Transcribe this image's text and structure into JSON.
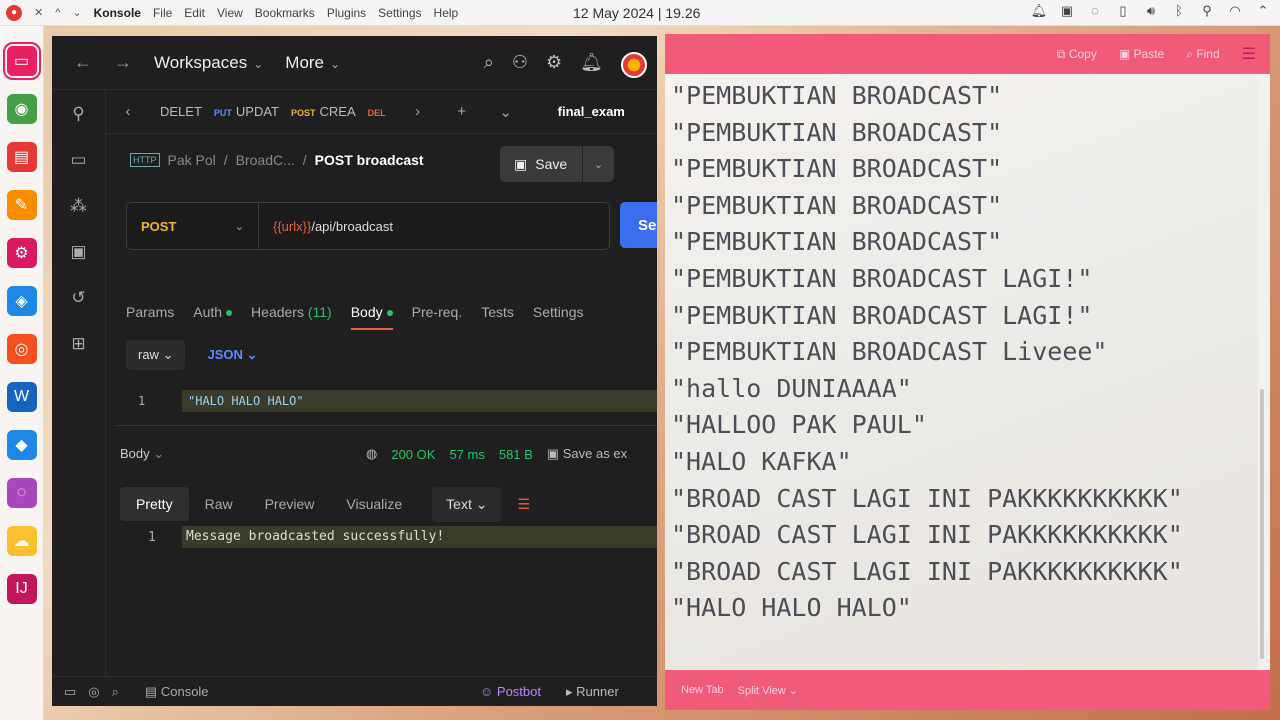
{
  "topbar": {
    "controls": [
      "✕",
      "^",
      "⌄"
    ],
    "app_name": "Konsole",
    "menu": [
      "File",
      "Edit",
      "View",
      "Bookmarks",
      "Plugins",
      "Settings",
      "Help"
    ],
    "clock": "12 May 2024 | 19.26"
  },
  "dock": {
    "items": [
      {
        "name": "konsole-icon",
        "color": "#e91e63",
        "glyph": "▭"
      },
      {
        "name": "chrome-icon",
        "color": "#43a047",
        "glyph": "◉"
      },
      {
        "name": "folder-icon",
        "color": "#e53935",
        "glyph": "▤"
      },
      {
        "name": "editor-icon",
        "color": "#fb8c00",
        "glyph": "✎"
      },
      {
        "name": "settings-icon",
        "color": "#d81b60",
        "glyph": "⚙"
      },
      {
        "name": "box-icon",
        "color": "#1e88e5",
        "glyph": "◈"
      },
      {
        "name": "postman-icon",
        "color": "#f4511e",
        "glyph": "◎"
      },
      {
        "name": "word-icon",
        "color": "#1565c0",
        "glyph": "W"
      },
      {
        "name": "docker-icon",
        "color": "#1e88e5",
        "glyph": "◆"
      },
      {
        "name": "obs-icon",
        "color": "#ab47bc",
        "glyph": "◌"
      },
      {
        "name": "weather-icon",
        "color": "#fbc02d",
        "glyph": "☁"
      },
      {
        "name": "intellij-icon",
        "color": "#c2185b",
        "glyph": "IJ"
      }
    ]
  },
  "postman": {
    "header": {
      "workspaces": "Workspaces",
      "more": "More"
    },
    "tabs": [
      {
        "method": "",
        "label": "DELET",
        "method_color": "#e5643d"
      },
      {
        "method": "PUT",
        "label": "UPDAT",
        "method_color": "#5b8cff"
      },
      {
        "method": "POST",
        "label": "CREA",
        "method_color": "#f0b33a"
      },
      {
        "method": "DEL",
        "label": "",
        "method_color": "#e5643d"
      }
    ],
    "active_tab": "final_exam",
    "breadcrumb": {
      "http": "HTTP",
      "collection": "Pak Pol",
      "folder": "BroadC...",
      "current": "POST broadcast"
    },
    "save_label": "Save",
    "request": {
      "method": "POST",
      "url_var": "{{urlx}}",
      "url_path": "/api/broadcast",
      "send_label": "Se"
    },
    "req_tabs": {
      "params": "Params",
      "auth": "Auth",
      "headers": "Headers",
      "headers_count": "(11)",
      "body": "Body",
      "prereq": "Pre-req.",
      "tests": "Tests",
      "settings": "Settings"
    },
    "body_opts": {
      "mode": "raw",
      "format": "JSON"
    },
    "request_body": {
      "line": "1",
      "code": "\"HALO HALO HALO\""
    },
    "response": {
      "label": "Body",
      "status": "200 OK",
      "time": "57 ms",
      "size": "581 B",
      "save_as": "Save as ex"
    },
    "res_tabs": {
      "pretty": "Pretty",
      "raw": "Raw",
      "preview": "Preview",
      "visualize": "Visualize",
      "format": "Text"
    },
    "response_body": {
      "line": "1",
      "code": "Message broadcasted successfully!"
    },
    "footer": {
      "console": "Console",
      "postbot": "Postbot",
      "runner": "Runner"
    }
  },
  "konsole": {
    "header": {
      "copy": "Copy",
      "paste": "Paste",
      "find": "Find"
    },
    "lines": [
      "\"PEMBUKTIAN BROADCAST\"",
      "\"PEMBUKTIAN BROADCAST\"",
      "\"PEMBUKTIAN BROADCAST\"",
      "\"PEMBUKTIAN BROADCAST\"",
      "\"PEMBUKTIAN BROADCAST\"",
      "\"PEMBUKTIAN BROADCAST LAGI!\"",
      "\"PEMBUKTIAN BROADCAST LAGI!\"",
      "\"PEMBUKTIAN BROADCAST Liveee\"",
      "\"hallo DUNIAAAA\"",
      "\"HALLOO PAK PAUL\"",
      "\"HALO KAFKA\"",
      "\"BROAD CAST LAGI INI PAKKKKKKKKKK\"",
      "\"BROAD CAST LAGI INI PAKKKKKKKKKK\"",
      "\"BROAD CAST LAGI INI PAKKKKKKKKKK\"",
      "\"HALO HALO HALO\""
    ],
    "footer": {
      "new_tab": "New Tab",
      "split_view": "Split View"
    }
  }
}
